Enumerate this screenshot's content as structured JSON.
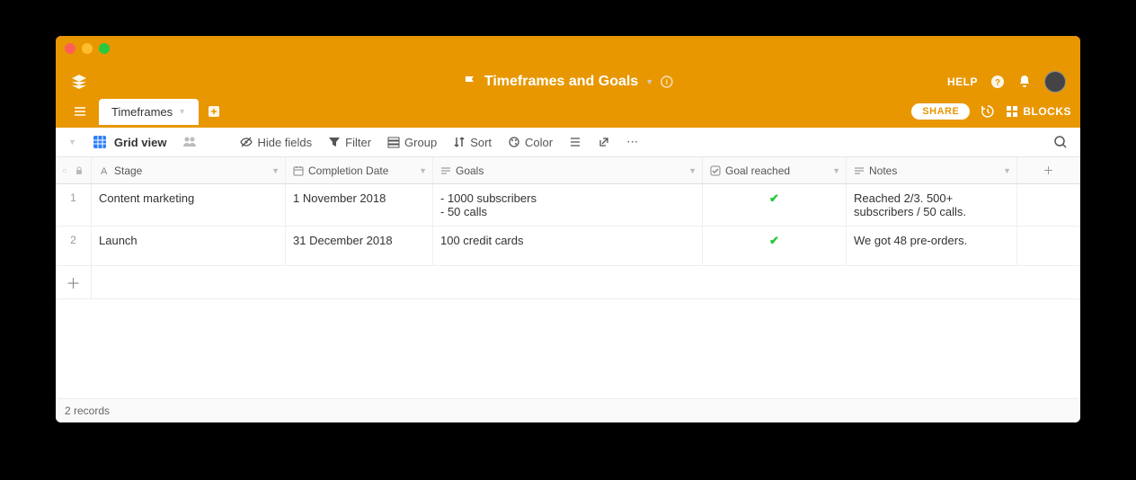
{
  "base": {
    "title": "Timeframes and Goals"
  },
  "header": {
    "help": "HELP"
  },
  "tabs": {
    "active": "Timeframes",
    "share": "SHARE",
    "blocks": "BLOCKS"
  },
  "toolbar": {
    "view": "Grid view",
    "hide_fields": "Hide fields",
    "filter": "Filter",
    "group": "Group",
    "sort": "Sort",
    "color": "Color"
  },
  "columns": {
    "stage": "Stage",
    "completion_date": "Completion Date",
    "goals": "Goals",
    "goal_reached": "Goal reached",
    "notes": "Notes"
  },
  "rows": [
    {
      "num": "1",
      "stage": "Content marketing",
      "date": "1 November 2018",
      "goals": "- 1000 subscribers\n- 50 calls",
      "reached": true,
      "notes": "Reached 2/3. 500+ subscribers / 50 calls."
    },
    {
      "num": "2",
      "stage": "Launch",
      "date": "31 December 2018",
      "goals": "100 credit cards",
      "reached": true,
      "notes": "We got 48 pre-orders."
    }
  ],
  "footer": {
    "records": "2 records"
  }
}
